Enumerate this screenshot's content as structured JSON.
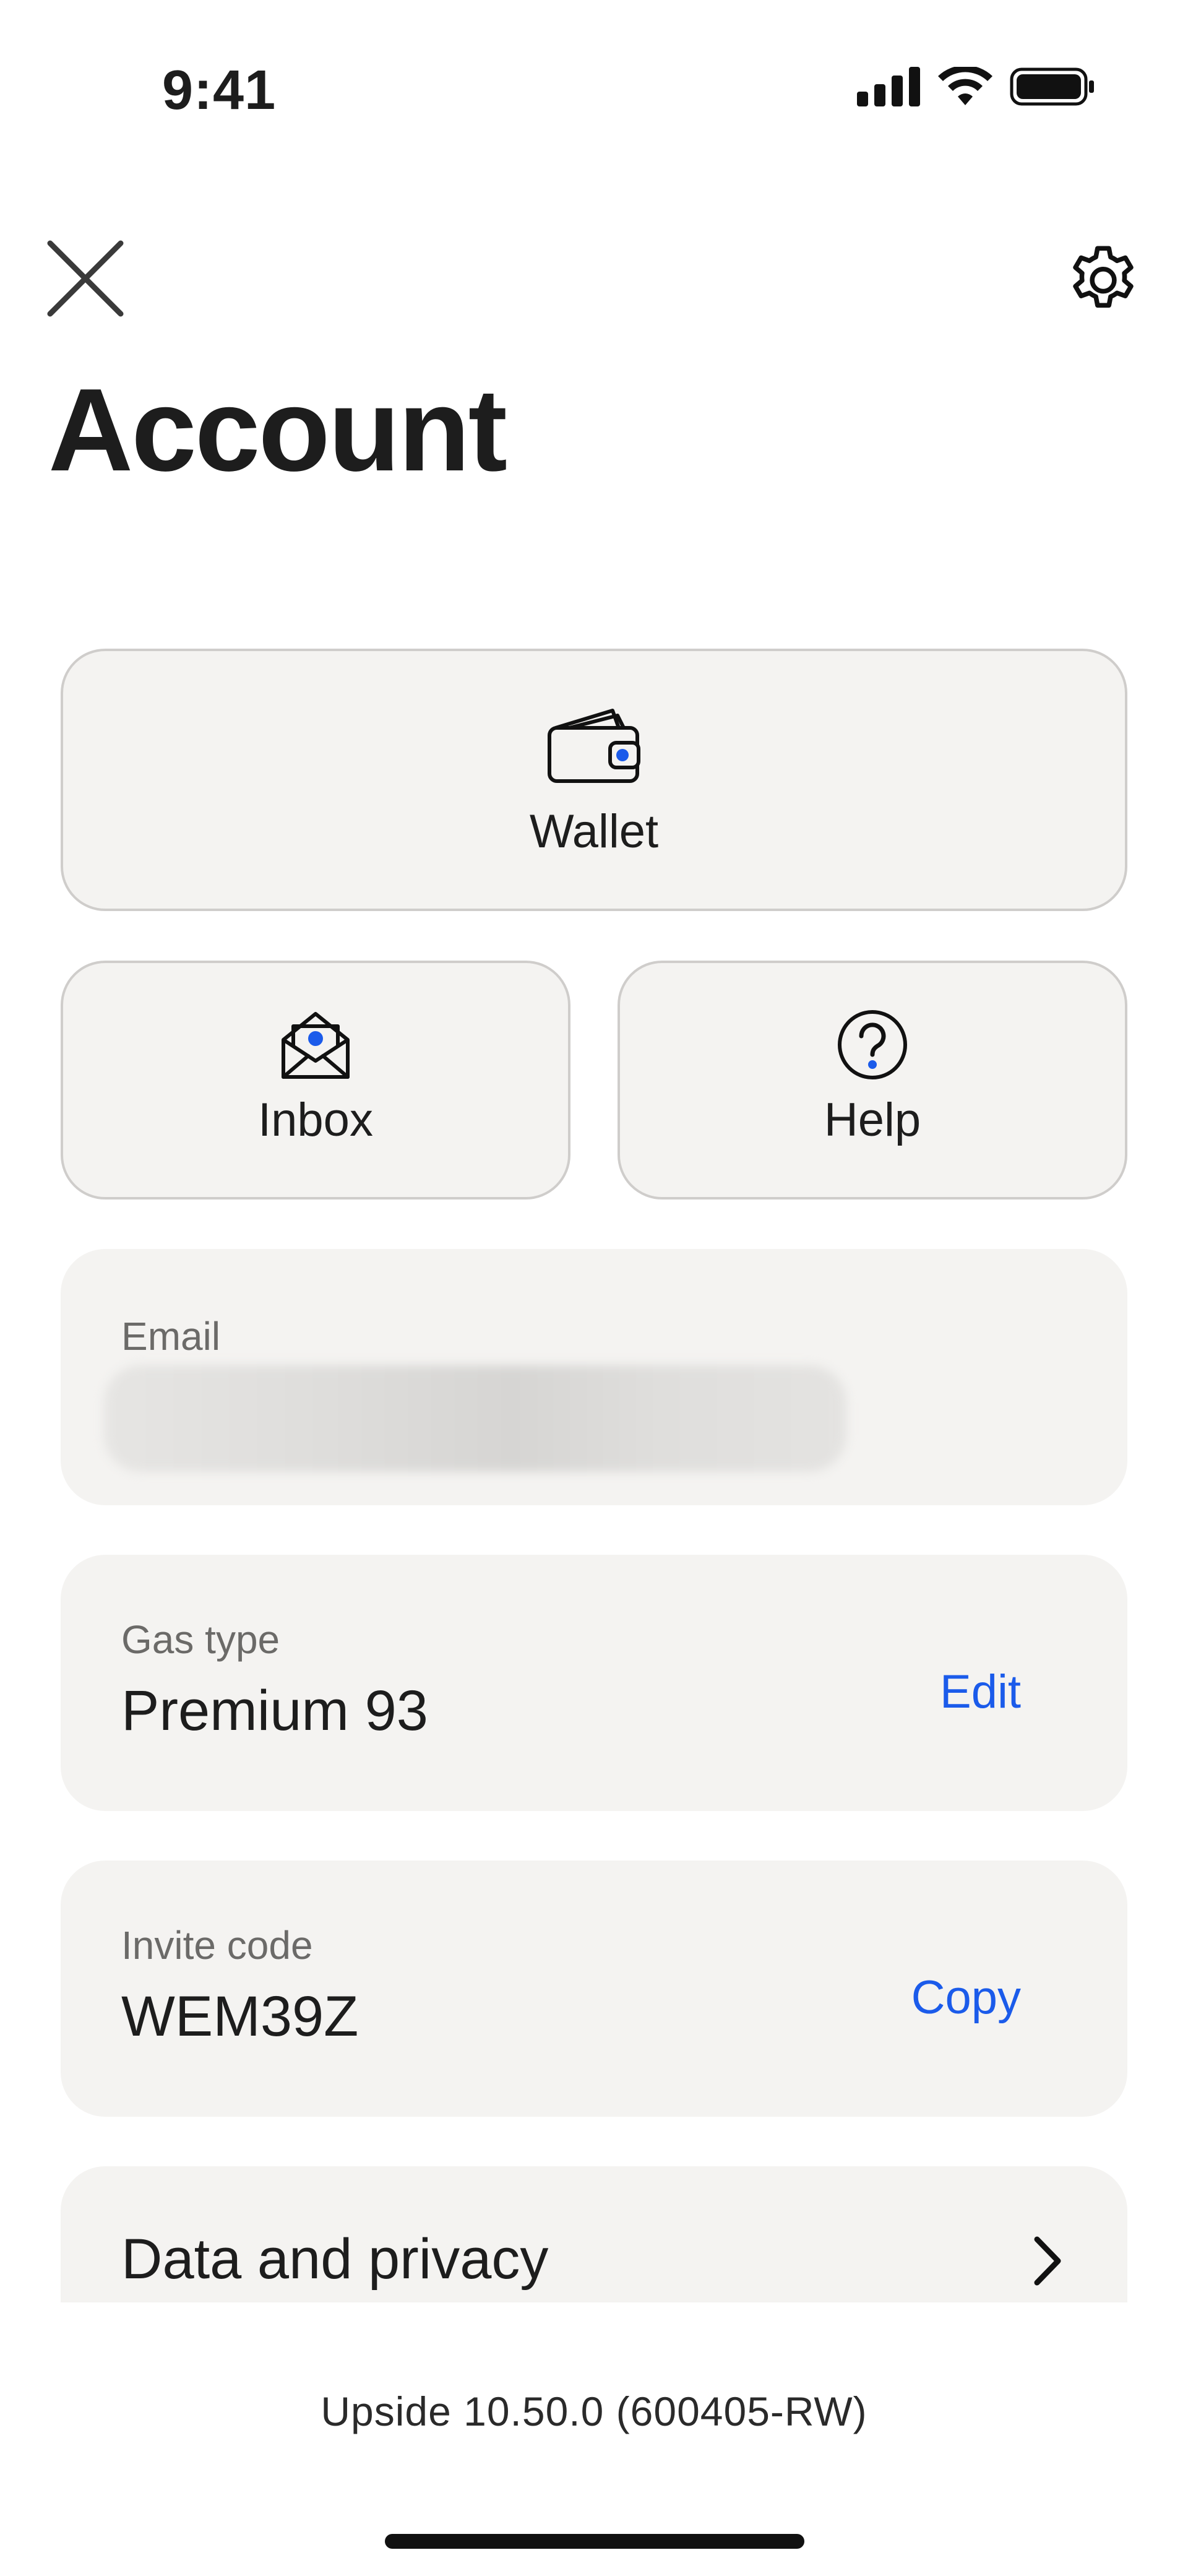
{
  "status_bar": {
    "time": "9:41"
  },
  "page": {
    "title": "Account"
  },
  "tiles": {
    "wallet": {
      "label": "Wallet",
      "icon": "wallet-icon"
    },
    "inbox": {
      "label": "Inbox",
      "icon": "envelope-open-icon"
    },
    "help": {
      "label": "Help",
      "icon": "question-circle-icon"
    }
  },
  "email": {
    "label": "Email"
  },
  "gas": {
    "label": "Gas type",
    "value": "Premium 93",
    "action": "Edit"
  },
  "invite": {
    "label": "Invite code",
    "value": "WEM39Z",
    "action": "Copy"
  },
  "privacy": {
    "label": "Data and privacy"
  },
  "footer": {
    "version": "Upside 10.50.0 (600405-RW)"
  },
  "colors": {
    "accent": "#1b5bea",
    "card_bg": "#f4f3f1",
    "card_border": "#cfcdcb",
    "text": "#1d1d1d"
  }
}
